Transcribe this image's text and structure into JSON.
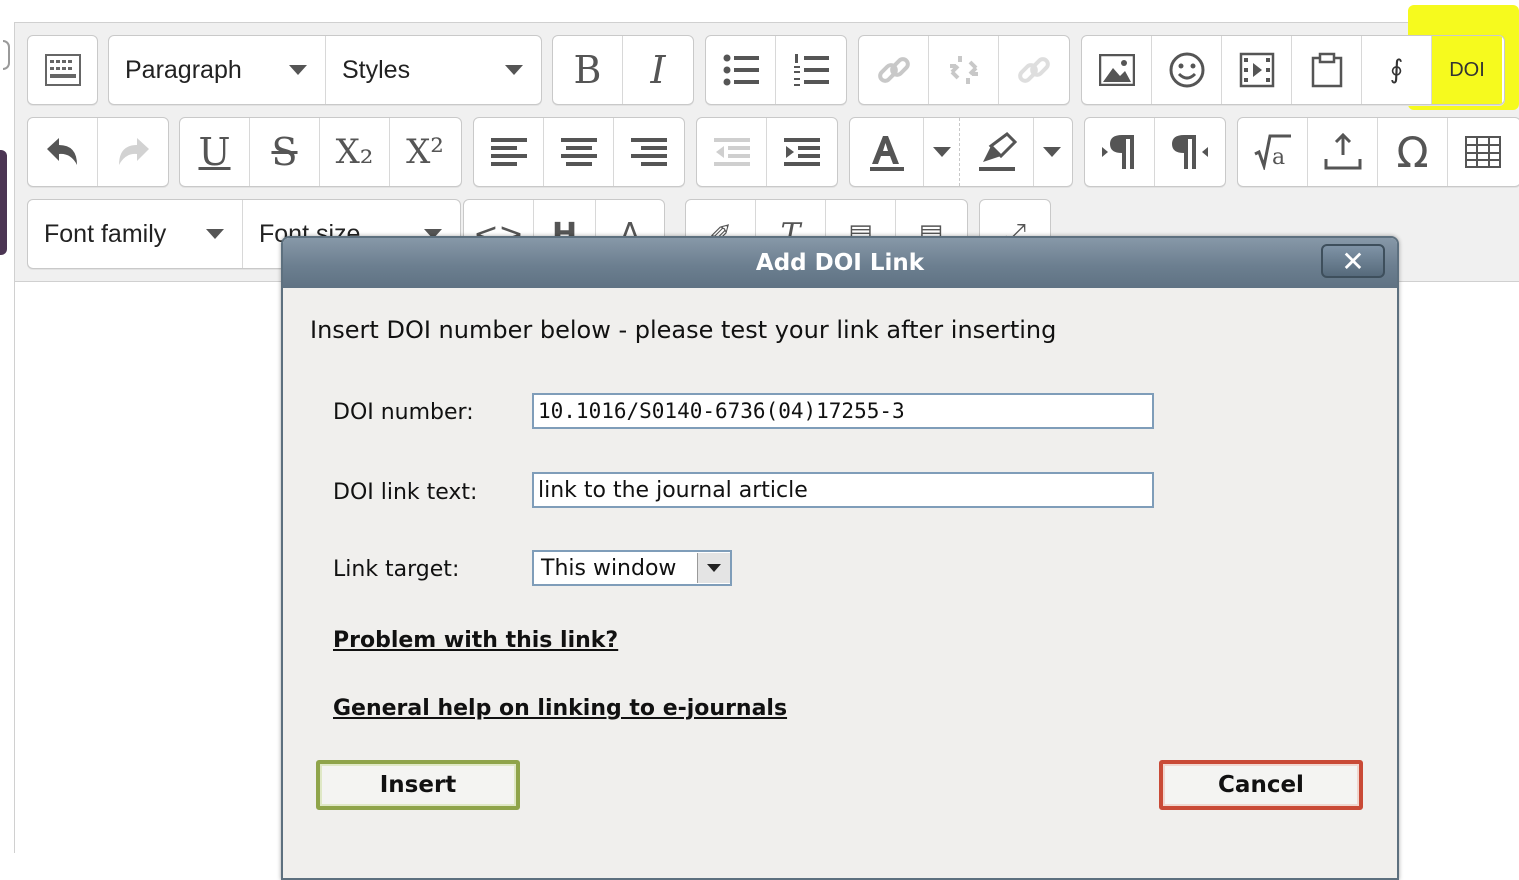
{
  "toolbar": {
    "row1": {
      "paragraph_label": "Paragraph",
      "styles_label": "Styles",
      "bold_label": "B",
      "italic_label": "I",
      "doi_label": "DOI",
      "icons": [
        "toolbar-toggle-icon",
        "bold-icon",
        "italic-icon",
        "bullet-list-icon",
        "numbered-list-icon",
        "link-icon",
        "unlink-icon",
        "anchor-icon",
        "image-icon",
        "emoticon-icon",
        "media-icon",
        "paste-icon",
        "spellcheck-icon",
        "doi-icon"
      ]
    },
    "row2": {
      "underline_label": "U",
      "strike_label": "S",
      "subscript_label": "X₂",
      "superscript_label": "X²",
      "icons": [
        "undo-icon",
        "redo-icon",
        "underline-icon",
        "strikethrough-icon",
        "subscript-icon",
        "superscript-icon",
        "align-left-icon",
        "align-center-icon",
        "align-right-icon",
        "outdent-icon",
        "indent-icon",
        "text-color-icon",
        "highlight-icon",
        "ltr-icon",
        "rtl-icon",
        "equation-icon",
        "upload-icon",
        "special-character-icon",
        "table-icon"
      ]
    },
    "row3": {
      "font_family_label": "Font family",
      "font_size_label": "Font size"
    },
    "highlight_color": "#f6fa1e"
  },
  "dialog": {
    "title": "Add DOI Link",
    "close_label": "✕",
    "instruction": "Insert DOI number below - please test your link after inserting",
    "doi_number_label": "DOI number:",
    "doi_number_value": "10.1016/S0140-6736(04)17255-3",
    "doi_text_label": "DOI link text:",
    "doi_text_value": "link to the journal article",
    "target_label": "Link target:",
    "target_value": "This window",
    "problem_link": "Problem with this link?",
    "help_link": "General help on linking to e-journals",
    "insert_label": "Insert",
    "cancel_label": "Cancel",
    "insert_border_color": "#8fa44a",
    "cancel_border_color": "#c94a36"
  }
}
